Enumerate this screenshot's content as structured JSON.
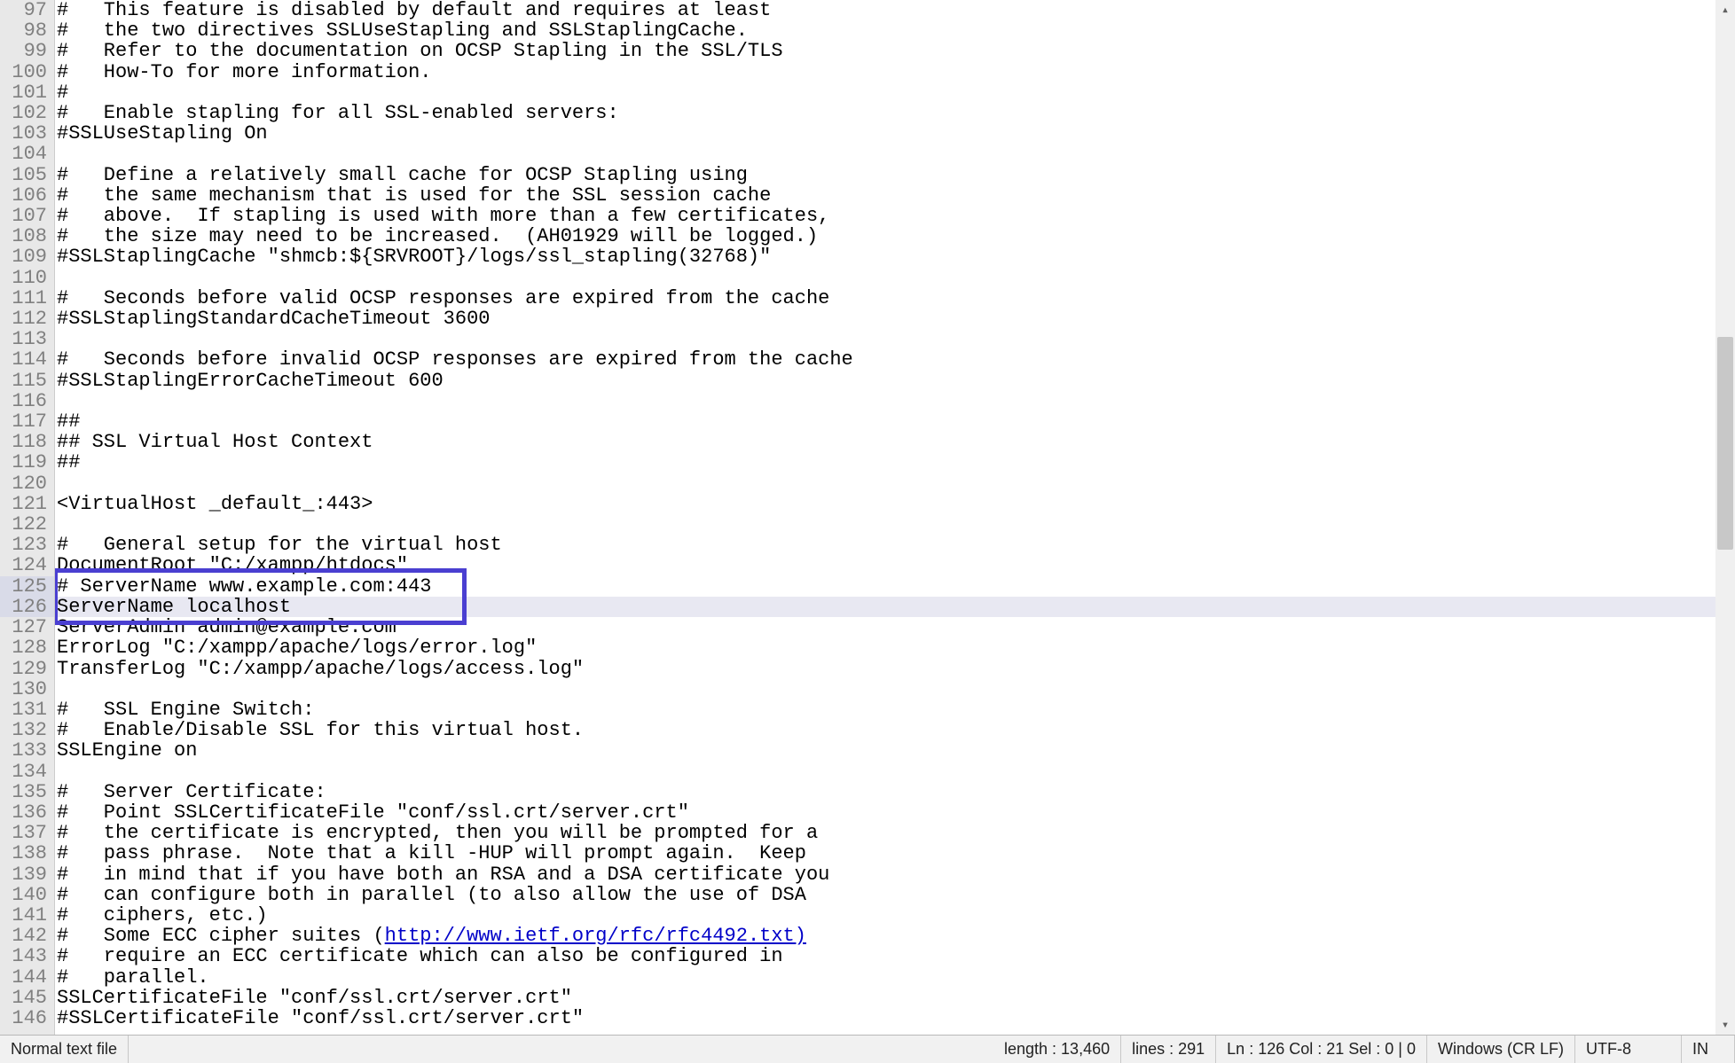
{
  "editor": {
    "first_line_no": 97,
    "highlighted_line_nos": [
      125,
      126
    ],
    "current_line_no": 126,
    "lines": [
      "#   This feature is disabled by default and requires at least",
      "#   the two directives SSLUseStapling and SSLStaplingCache.",
      "#   Refer to the documentation on OCSP Stapling in the SSL/TLS",
      "#   How-To for more information.",
      "#",
      "#   Enable stapling for all SSL-enabled servers:",
      "#SSLUseStapling On",
      "",
      "#   Define a relatively small cache for OCSP Stapling using",
      "#   the same mechanism that is used for the SSL session cache",
      "#   above.  If stapling is used with more than a few certificates,",
      "#   the size may need to be increased.  (AH01929 will be logged.)",
      "#SSLStaplingCache \"shmcb:${SRVROOT}/logs/ssl_stapling(32768)\"",
      "",
      "#   Seconds before valid OCSP responses are expired from the cache",
      "#SSLStaplingStandardCacheTimeout 3600",
      "",
      "#   Seconds before invalid OCSP responses are expired from the cache",
      "#SSLStaplingErrorCacheTimeout 600",
      "",
      "##",
      "## SSL Virtual Host Context",
      "##",
      "",
      "<VirtualHost _default_:443>",
      "",
      "#   General setup for the virtual host",
      "DocumentRoot \"C:/xampp/htdocs\"",
      "# ServerName www.example.com:443",
      "ServerName localhost",
      "ServerAdmin admin@example.com",
      "ErrorLog \"C:/xampp/apache/logs/error.log\"",
      "TransferLog \"C:/xampp/apache/logs/access.log\"",
      "",
      "#   SSL Engine Switch:",
      "#   Enable/Disable SSL for this virtual host.",
      "SSLEngine on",
      "",
      "#   Server Certificate:",
      "#   Point SSLCertificateFile \"conf/ssl.crt/server.crt\"",
      "#   the certificate is encrypted, then you will be prompted for a",
      "#   pass phrase.  Note that a kill -HUP will prompt again.  Keep",
      "#   in mind that if you have both an RSA and a DSA certificate you",
      "#   can configure both in parallel (to also allow the use of DSA",
      "#   ciphers, etc.)",
      "#   Some ECC cipher suites (http://www.ietf.org/rfc/rfc4492.txt)",
      "#   require an ECC certificate which can also be configured in",
      "#   parallel.",
      "SSLCertificateFile \"conf/ssl.crt/server.crt\"",
      "#SSLCertificateFile \"conf/ssl.crt/server.crt\""
    ],
    "link_line_no": 142,
    "link_prefix": "#   Some ECC cipher suites (",
    "link_text": "http://www.ietf.org/rfc/rfc4492.txt)"
  },
  "statusbar": {
    "file_type": "Normal text file",
    "length": "length : 13,460",
    "lines": "lines : 291",
    "pos": "Ln : 126   Col : 21   Sel : 0 | 0",
    "eol": "Windows (CR LF)",
    "encoding": "UTF-8",
    "ins": "IN"
  }
}
